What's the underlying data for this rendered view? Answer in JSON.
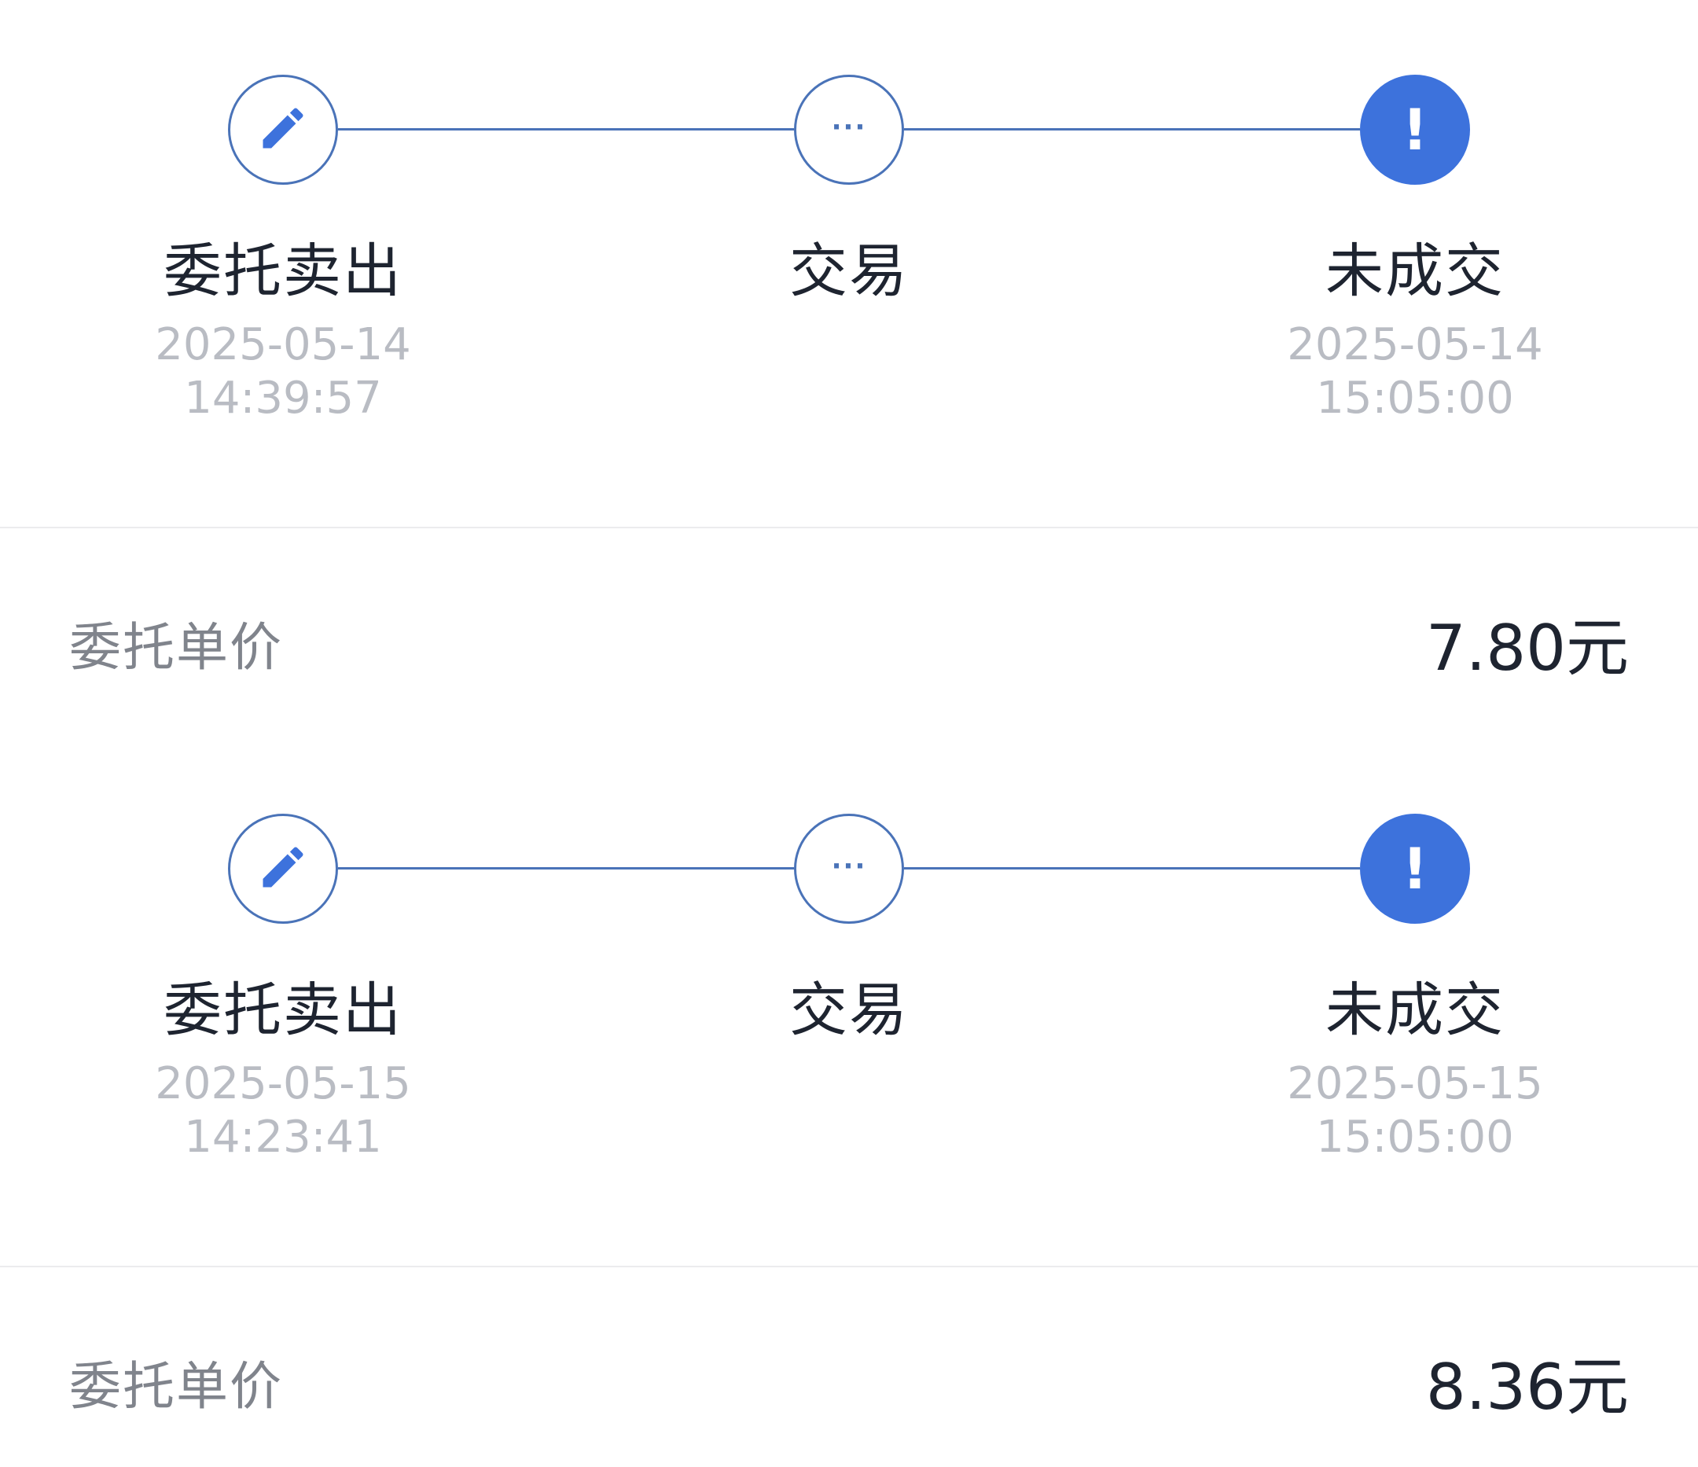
{
  "orders": [
    {
      "steps": [
        {
          "icon": "pencil-icon",
          "label": "委托卖出",
          "date": "2025-05-14",
          "time": "14:39:57"
        },
        {
          "icon": "ellipsis-icon",
          "symbol": "···",
          "label": "交易",
          "date": "",
          "time": ""
        },
        {
          "icon": "exclamation-icon",
          "symbol": "!",
          "label": "未成交",
          "date": "2025-05-14",
          "time": "15:05:00"
        }
      ],
      "price_label": "委托单价",
      "price_value": "7.80元"
    },
    {
      "steps": [
        {
          "icon": "pencil-icon",
          "label": "委托卖出",
          "date": "2025-05-15",
          "time": "14:23:41"
        },
        {
          "icon": "ellipsis-icon",
          "symbol": "···",
          "label": "交易",
          "date": "",
          "time": ""
        },
        {
          "icon": "exclamation-icon",
          "symbol": "!",
          "label": "未成交",
          "date": "2025-05-15",
          "time": "15:05:00"
        }
      ],
      "price_label": "委托单价",
      "price_value": "8.36元"
    }
  ],
  "colors": {
    "accent": "#3d72dc",
    "line": "#4a73b8",
    "text_primary": "#1e2430",
    "text_secondary": "#80848c",
    "text_muted": "#b9bcc3",
    "divider": "#ececee"
  }
}
